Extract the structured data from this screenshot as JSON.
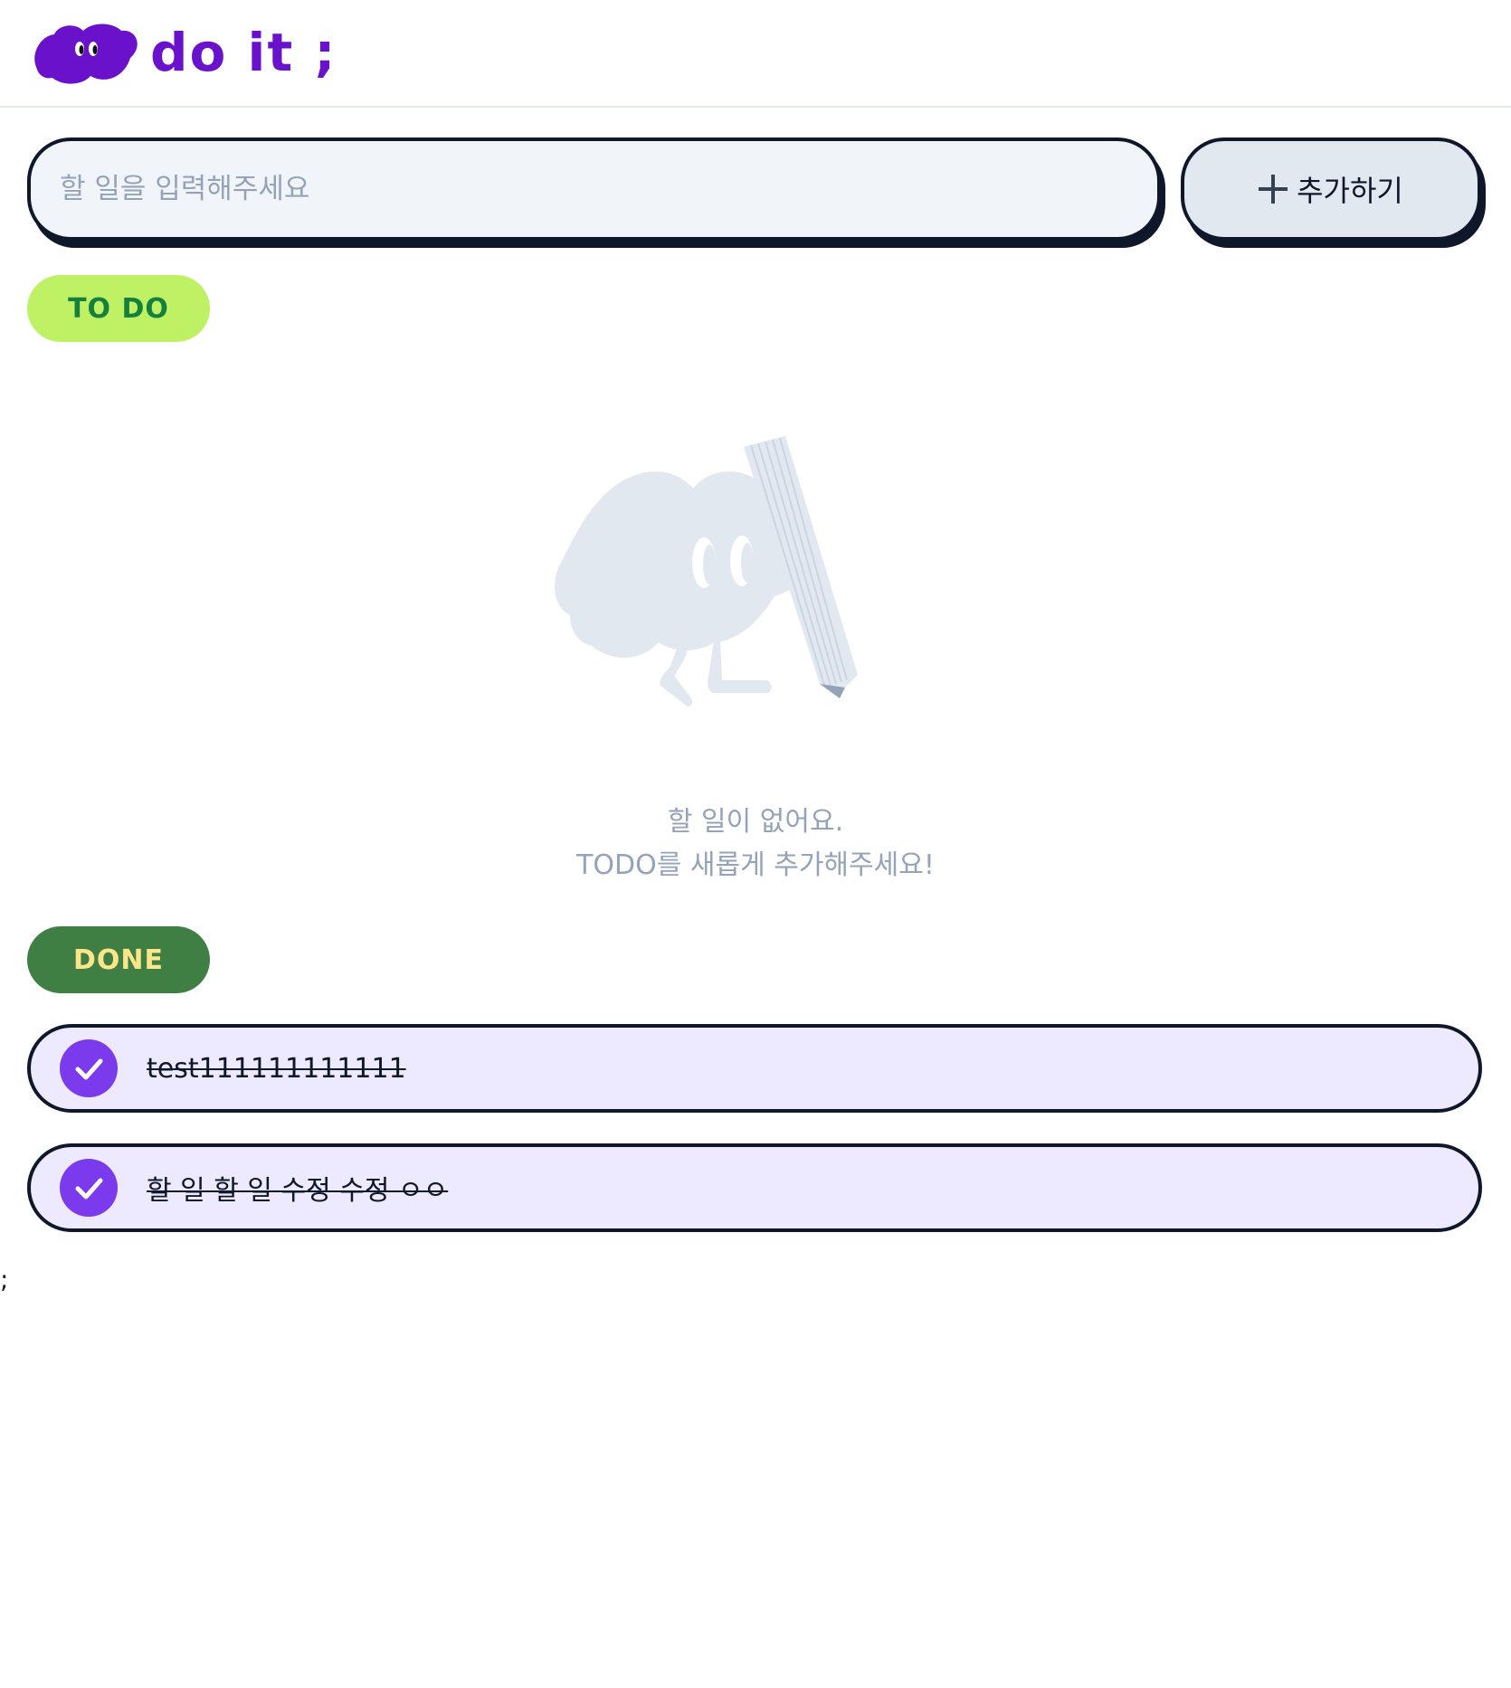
{
  "header": {
    "logo_text": "do it ;"
  },
  "form": {
    "input_placeholder": "할 일을 입력해주세요",
    "input_value": "",
    "add_label": "추가하기"
  },
  "todo": {
    "badge": "TO DO",
    "empty_line1": "할 일이 없어요.",
    "empty_line2": "TODO를 새롭게 추가해주세요!"
  },
  "done": {
    "badge": "DONE",
    "items": [
      {
        "label": "test111111111111",
        "checked": true
      },
      {
        "label": "할 일 할 일 수정 수정 ㅇㅇ",
        "checked": true
      }
    ]
  },
  "stray_text": ";",
  "colors": {
    "brand": "#6a11cb",
    "todo_badge_bg": "#bef264",
    "todo_badge_fg": "#15803d",
    "done_badge_bg": "#3f7f44",
    "done_badge_fg": "#fde68a",
    "done_item_bg": "#ede9fe",
    "check": "#7c3aed",
    "outline": "#0f172a"
  },
  "icons": {
    "logo": "purple-cloud-with-eyes-icon",
    "add": "plus-icon",
    "check": "check-circle-icon",
    "empty_state": "cloud-character-holding-pencil-illustration"
  }
}
